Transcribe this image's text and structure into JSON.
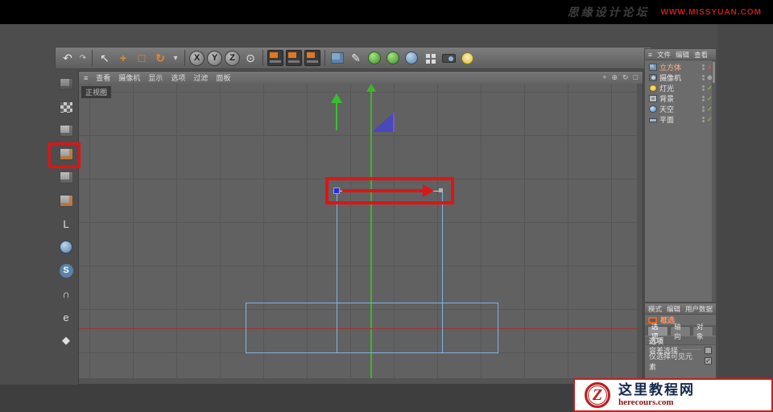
{
  "banner": {
    "title": "思缘设计论坛",
    "url": "WWW.MISSYUAN.COM"
  },
  "toolbar": {
    "undo_icon": "↶",
    "redo_icon": "↷",
    "select_icon": "↖",
    "move_icon": "+",
    "scale_icon": "□",
    "rotate_icon": "↻",
    "dropdown_icon": "▾",
    "axis_x": "X",
    "axis_y": "Y",
    "axis_z": "Z",
    "coord_icon": "⊙",
    "pen_icon": "✎"
  },
  "left_tools": {
    "axis": "L",
    "snap": "S",
    "magnet": "∩",
    "mesh": "e",
    "workplane": "◆"
  },
  "viewport": {
    "menu_icon": "≡",
    "menus": [
      "查看",
      "摄像机",
      "显示",
      "选项",
      "过滤",
      "面板"
    ],
    "label": "正视图",
    "nav": [
      "+",
      "⊕",
      "↻",
      "□"
    ]
  },
  "object_manager": {
    "menu_icon": "≡",
    "menus": [
      "文件",
      "编辑",
      "查看"
    ],
    "objects": [
      {
        "name": "立方体",
        "name_color": "#ffb089",
        "mark": "✗",
        "mark_color": "#e05050"
      },
      {
        "name": "摄像机",
        "name_color": "#e8e8e8",
        "mark": "⊕",
        "mark_color": "#c0c0c0"
      },
      {
        "name": "灯光",
        "name_color": "#e8e8e8",
        "mark": "✓",
        "mark_color": "#8ed44a"
      },
      {
        "name": "背景",
        "name_color": "#e8e8e8",
        "mark": "✓",
        "mark_color": "#8ed44a"
      },
      {
        "name": "天空",
        "name_color": "#e8e8e8",
        "mark": "✓",
        "mark_color": "#8ed44a"
      },
      {
        "name": "平面",
        "name_color": "#e8e8e8",
        "mark": "✓",
        "mark_color": "#8ed44a"
      }
    ]
  },
  "attributes": {
    "menus": [
      "模式",
      "编辑",
      "用户数据"
    ],
    "tool_label": "框选",
    "tabs": [
      "选项",
      "轴向",
      "对象"
    ],
    "section_title": "选项",
    "options": [
      {
        "label": "容差选择",
        "mark": ""
      },
      {
        "label": "仅选择可见元素",
        "mark": "✓"
      }
    ]
  },
  "watermark": {
    "logo": "Z",
    "name": "这里教程网",
    "url": "herecours.com"
  }
}
